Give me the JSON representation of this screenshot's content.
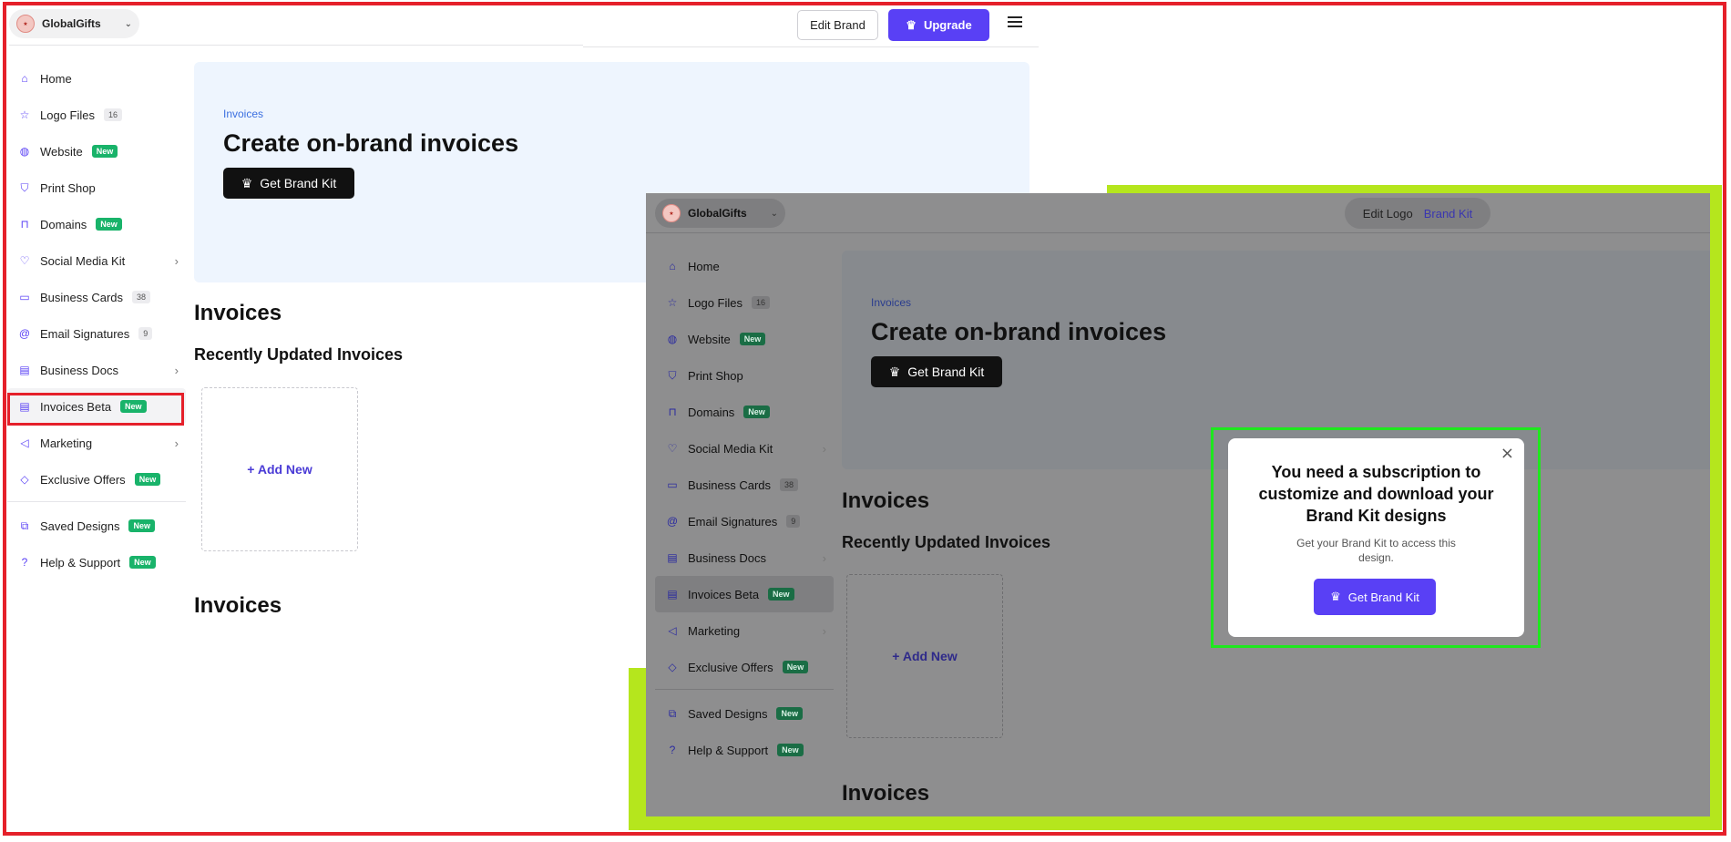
{
  "workspace": {
    "name": "GlobalGifts"
  },
  "header": {
    "edit_brand": "Edit Brand",
    "upgrade": "Upgrade"
  },
  "sidebar": {
    "items": [
      {
        "label": "Home",
        "icon": "home-icon"
      },
      {
        "label": "Logo Files",
        "icon": "star-icon",
        "count": "16"
      },
      {
        "label": "Website",
        "icon": "globe-icon",
        "badge": "New"
      },
      {
        "label": "Print Shop",
        "icon": "shirt-icon"
      },
      {
        "label": "Domains",
        "icon": "bookmark-icon",
        "badge": "New"
      },
      {
        "label": "Social Media Kit",
        "icon": "heart-icon"
      },
      {
        "label": "Business Cards",
        "icon": "cards-icon",
        "count": "38"
      },
      {
        "label": "Email Signatures",
        "icon": "at-icon",
        "count": "9"
      },
      {
        "label": "Business Docs",
        "icon": "doc-icon"
      },
      {
        "label": "Invoices Beta",
        "icon": "invoice-icon",
        "badge": "New"
      },
      {
        "label": "Marketing",
        "icon": "megaphone-icon"
      },
      {
        "label": "Exclusive Offers",
        "icon": "tag-icon",
        "badge": "New"
      },
      {
        "label": "Saved Designs",
        "icon": "saved-icon",
        "badge": "New"
      },
      {
        "label": "Help & Support",
        "icon": "help-icon",
        "badge": "New"
      }
    ]
  },
  "hero": {
    "crumb": "Invoices",
    "title": "Create on-brand invoices",
    "cta": "Get Brand Kit"
  },
  "main": {
    "section_title": "Invoices",
    "recent_title": "Recently Updated Invoices",
    "add_new": "+ Add New",
    "section_title_2": "Invoices"
  },
  "overlay": {
    "tabs": {
      "edit_logo": "Edit Logo",
      "brand_kit": "Brand Kit"
    }
  },
  "modal": {
    "title": "You need a subscription to customize and download your Brand Kit designs",
    "subtitle": "Get your Brand Kit to access this design.",
    "cta": "Get Brand Kit",
    "close": "×"
  },
  "colors": {
    "accent": "#5940f5",
    "badge_green": "#19b36a",
    "highlight_red": "#e5202a",
    "highlight_green": "#1ee81e",
    "lime": "#b5e61d"
  }
}
